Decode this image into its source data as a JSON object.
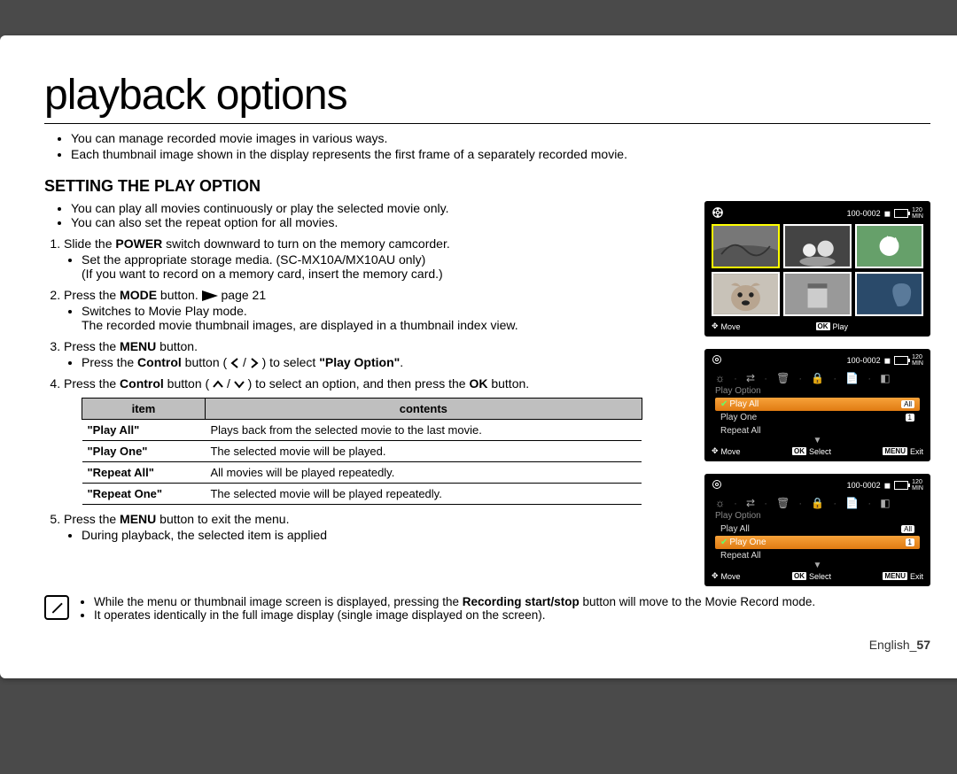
{
  "title": "playback options",
  "intro": [
    "You can manage recorded movie images in various ways.",
    "Each thumbnail image shown in the display represents the first frame of a separately recorded movie."
  ],
  "section_title": "SETTING THE PLAY OPTION",
  "top_bullets": [
    "You can play all movies continuously or play the selected movie only.",
    "You can also set the repeat option for all movies."
  ],
  "steps": {
    "s1_a": "Slide the ",
    "s1_b": "POWER",
    "s1_c": " switch downward to turn on the memory camcorder.",
    "s1_sub1": "Set the appropriate storage media. (SC-MX10A/MX10AU only)",
    "s1_sub1_paren": "(If you want to record on a memory card, insert the memory card.)",
    "s2_a": "Press the ",
    "s2_b": "MODE",
    "s2_c": " button.",
    "s2_page": "page 21",
    "s2_sub1": "Switches to Movie Play mode.",
    "s2_sub1b": "The recorded movie thumbnail images, are displayed in a thumbnail index view.",
    "s3_a": "Press the ",
    "s3_b": "MENU",
    "s3_c": " button.",
    "s3_sub_a": "Press the ",
    "s3_sub_b": "Control",
    "s3_sub_c": " button ( ",
    "s3_sub_d": " ) to select ",
    "s3_sub_e": "\"Play Option\"",
    "s3_sub_f": ".",
    "s4_a": "Press the ",
    "s4_b": "Control",
    "s4_c": " button ( ",
    "s4_d": " ) to select an option, and then press the ",
    "s4_e": "OK",
    "s4_f": " button.",
    "s5_a": "Press the ",
    "s5_b": "MENU",
    "s5_c": " button to exit the menu.",
    "s5_sub": "During playback, the selected item is applied"
  },
  "table": {
    "h1": "item",
    "h2": "contents",
    "rows": [
      {
        "item": "\"Play All\"",
        "desc": "Plays back from the selected movie to the last movie."
      },
      {
        "item": "\"Play One\"",
        "desc": "The selected movie will be played."
      },
      {
        "item": "\"Repeat All\"",
        "desc": "All movies will be played repeatedly."
      },
      {
        "item": "\"Repeat One\"",
        "desc": "The selected movie will be played repeatedly."
      }
    ]
  },
  "notes": [
    {
      "a": "While the menu or thumbnail image screen is displayed, pressing the ",
      "bold": "Recording start/stop",
      "b": " button will move to the Movie Record mode."
    },
    {
      "a": "It operates identically in the full image display (single image displayed on the screen)."
    }
  ],
  "footer": {
    "lang": "English_",
    "page": "57"
  },
  "screens": {
    "status_code": "100-0002",
    "battery_time": "120",
    "battery_unit": "MIN",
    "move": "Move",
    "play": "Play",
    "select": "Select",
    "exit": "Exit",
    "ok": "OK",
    "menu": "MENU",
    "play_option": "Play Option",
    "items": {
      "play_all": "Play All",
      "play_one": "Play One",
      "repeat_all": "Repeat All",
      "badge_all": "All",
      "badge_one": "1"
    }
  }
}
